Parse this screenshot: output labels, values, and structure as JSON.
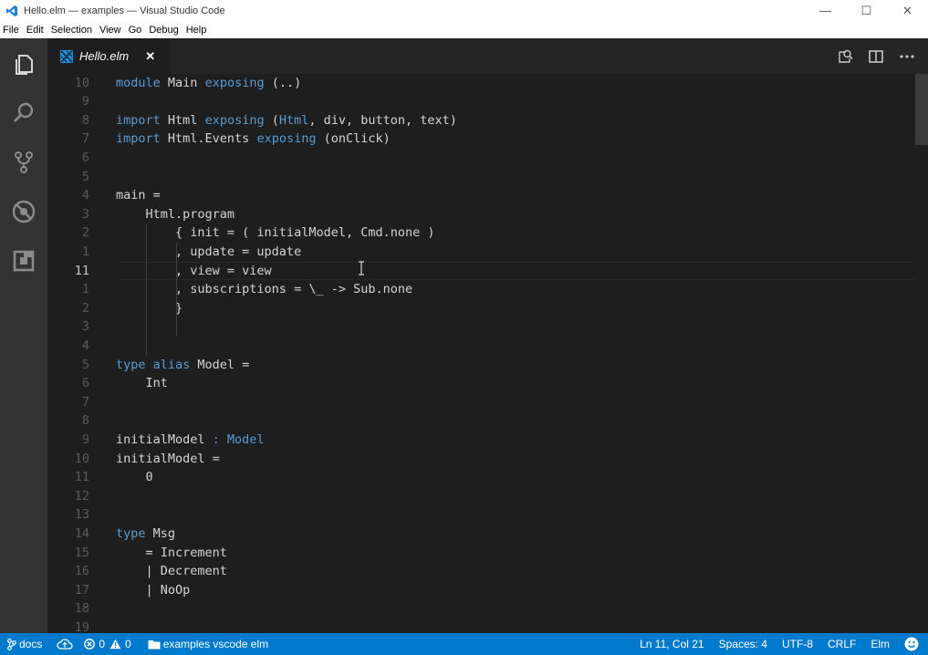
{
  "window": {
    "title": "Hello.elm — examples — Visual Studio Code",
    "minimize": "—",
    "maximize": "☐",
    "close": "✕"
  },
  "menu": [
    "File",
    "Edit",
    "Selection",
    "View",
    "Go",
    "Debug",
    "Help"
  ],
  "activity_bar": [
    "explorer-icon",
    "search-icon",
    "source-control-icon",
    "debug-icon",
    "extensions-icon"
  ],
  "tab": {
    "label": "Hello.elm",
    "close": "✕"
  },
  "editor": {
    "current_line": 11,
    "lines": [
      {
        "n": "10",
        "segments": [
          {
            "t": "module",
            "c": "kw"
          },
          {
            "t": " Main "
          },
          {
            "t": "exposing",
            "c": "kw"
          },
          {
            "t": " (..)"
          }
        ]
      },
      {
        "n": "9",
        "segments": []
      },
      {
        "n": "8",
        "segments": [
          {
            "t": "import",
            "c": "kw"
          },
          {
            "t": " Html "
          },
          {
            "t": "exposing",
            "c": "kw"
          },
          {
            "t": " ("
          },
          {
            "t": "Html",
            "c": "kw"
          },
          {
            "t": ", div, button, text)"
          }
        ]
      },
      {
        "n": "7",
        "segments": [
          {
            "t": "import",
            "c": "kw"
          },
          {
            "t": " Html.Events "
          },
          {
            "t": "exposing",
            "c": "kw"
          },
          {
            "t": " (onClick)"
          }
        ]
      },
      {
        "n": "6",
        "segments": []
      },
      {
        "n": "5",
        "segments": []
      },
      {
        "n": "4",
        "segments": [
          {
            "t": "main ="
          }
        ]
      },
      {
        "n": "3",
        "segments": [
          {
            "t": "    Html.program"
          }
        ]
      },
      {
        "n": "2",
        "segments": [
          {
            "t": "        { init = ( initialModel, Cmd.none )"
          }
        ]
      },
      {
        "n": "1",
        "segments": [
          {
            "t": "        , update = update"
          }
        ]
      },
      {
        "n": "11",
        "segments": [
          {
            "t": "        , view = view"
          }
        ]
      },
      {
        "n": "1",
        "segments": [
          {
            "t": "        , subscriptions = \\_ -> Sub.none"
          }
        ]
      },
      {
        "n": "2",
        "segments": [
          {
            "t": "        }"
          }
        ]
      },
      {
        "n": "3",
        "segments": []
      },
      {
        "n": "4",
        "segments": []
      },
      {
        "n": "5",
        "segments": [
          {
            "t": "type",
            "c": "kw"
          },
          {
            "t": " "
          },
          {
            "t": "alias",
            "c": "kw"
          },
          {
            "t": " Model ="
          }
        ]
      },
      {
        "n": "6",
        "segments": [
          {
            "t": "    Int"
          }
        ]
      },
      {
        "n": "7",
        "segments": []
      },
      {
        "n": "8",
        "segments": []
      },
      {
        "n": "9",
        "segments": [
          {
            "t": "initialModel "
          },
          {
            "t": ": Model",
            "c": "kw"
          }
        ]
      },
      {
        "n": "10",
        "segments": [
          {
            "t": "initialModel ="
          }
        ]
      },
      {
        "n": "11",
        "segments": [
          {
            "t": "    0"
          }
        ]
      },
      {
        "n": "12",
        "segments": []
      },
      {
        "n": "13",
        "segments": []
      },
      {
        "n": "14",
        "segments": [
          {
            "t": "type",
            "c": "kw"
          },
          {
            "t": " Msg"
          }
        ]
      },
      {
        "n": "15",
        "segments": [
          {
            "t": "    = Increment"
          }
        ]
      },
      {
        "n": "16",
        "segments": [
          {
            "t": "    | Decrement"
          }
        ]
      },
      {
        "n": "17",
        "segments": [
          {
            "t": "    | NoOp"
          }
        ]
      },
      {
        "n": "18",
        "segments": []
      },
      {
        "n": "19",
        "segments": []
      }
    ]
  },
  "status": {
    "branch": "docs",
    "errors": "0",
    "warnings": "0",
    "folder": "examples vscode elm",
    "position": "Ln 11, Col 21",
    "spaces": "Spaces: 4",
    "encoding": "UTF-8",
    "eol": "CRLF",
    "language": "Elm"
  },
  "colors": {
    "accent": "#007acc",
    "keyword": "#569cd6",
    "text": "#d4d4d4",
    "elm_logo": "#1a8fe0"
  }
}
